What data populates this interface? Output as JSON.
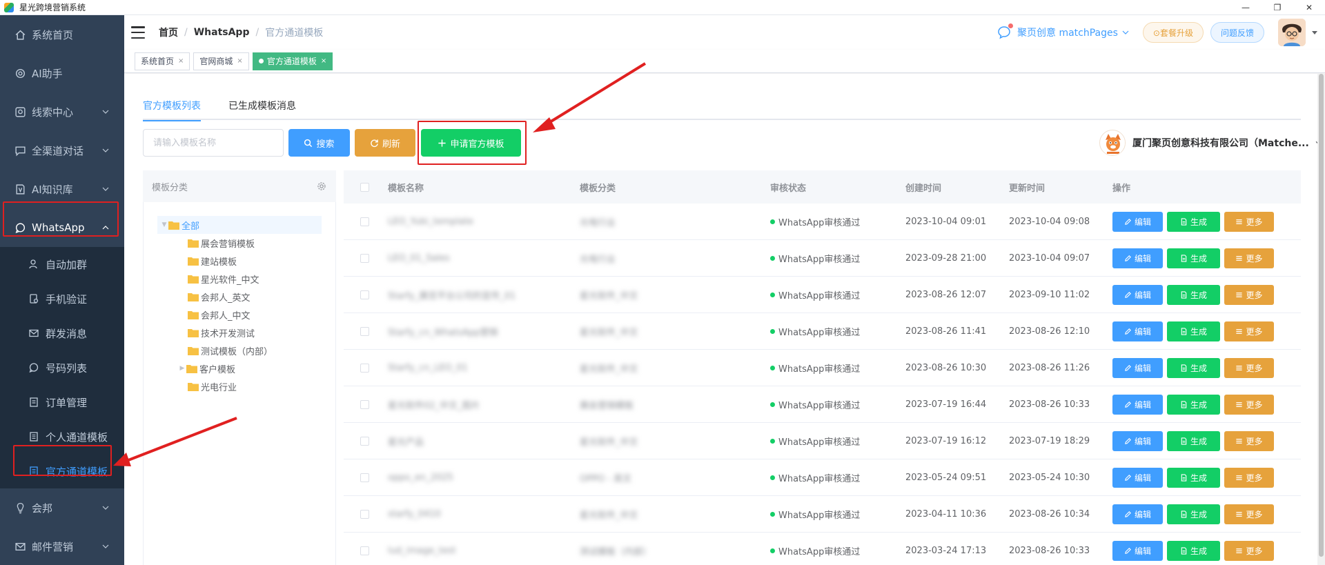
{
  "window": {
    "title": "星光跨境营销系统",
    "controls": [
      "—",
      "❐",
      "✕"
    ]
  },
  "sidebar": {
    "items": [
      {
        "label": "系统首页",
        "icon": "home-icon"
      },
      {
        "label": "AI助手",
        "icon": "ai-assistant-icon"
      },
      {
        "label": "线索中心",
        "icon": "clue-icon"
      },
      {
        "label": "全渠道对话",
        "icon": "chat-icon"
      },
      {
        "label": "AI知识库",
        "icon": "knowledge-icon"
      },
      {
        "label": "WhatsApp",
        "icon": "whatsapp-icon"
      },
      {
        "label": "会邦",
        "icon": "bulb-icon"
      },
      {
        "label": "邮件营销",
        "icon": "mail-icon"
      }
    ],
    "whatsapp_submenu": [
      {
        "label": "自动加群",
        "icon": "user-add-icon"
      },
      {
        "label": "手机验证",
        "icon": "phone-verify-icon"
      },
      {
        "label": "群发消息",
        "icon": "broadcast-icon"
      },
      {
        "label": "号码列表",
        "icon": "whatsapp-icon"
      },
      {
        "label": "订单管理",
        "icon": "order-icon"
      },
      {
        "label": "个人通道模板",
        "icon": "doc-icon"
      },
      {
        "label": "官方通道模板",
        "icon": "doc-icon"
      }
    ]
  },
  "header": {
    "breadcrumb": [
      "首页",
      "WhatsApp",
      "官方通道模板"
    ],
    "separator": "/",
    "company": "聚页创意 matchPages",
    "upgrade_label": "⊙套餐升级",
    "feedback_label": "问题反馈"
  },
  "tags": [
    {
      "label": "系统首页",
      "close": "×"
    },
    {
      "label": "官网商城",
      "close": "×"
    },
    {
      "label": "官方通道模板",
      "close": "×",
      "active": true
    }
  ],
  "tabs": [
    "官方模板列表",
    "已生成模板消息"
  ],
  "toolbar": {
    "search_placeholder": "请输入模板名称",
    "search_label": "搜索",
    "refresh_label": "刷新",
    "apply_label": "申请官方模板",
    "org_name": "厦门聚页创意科技有限公司（Matche..."
  },
  "category": {
    "header": "模板分类",
    "root": "全部",
    "nodes": [
      "展会营销模板",
      "建站模板",
      "星光软件_中文",
      "会邦人_英文",
      "会邦人_中文",
      "技术开发测试",
      "测试模板（内部）",
      "客户模板",
      "光电行业"
    ]
  },
  "table": {
    "columns": [
      "模板名称",
      "模板分类",
      "审核状态",
      "创建时间",
      "更新时间",
      "操作"
    ],
    "buttons": {
      "edit": "编辑",
      "generate": "生成",
      "more": "更多"
    },
    "rows": [
      {
        "name": "LEO_Yubi_template",
        "category": "光电行业",
        "status": "WhatsApp审核通过",
        "created": "2023-10-04 09:01",
        "updated": "2023-10-04 09:08"
      },
      {
        "name": "LEO_01_Sales",
        "category": "光电行业",
        "status": "WhatsApp审核通过",
        "created": "2023-09-28 21:00",
        "updated": "2023-10-04 09:07"
      },
      {
        "name": "Starfy_展览平台公司的宣传_01",
        "category": "星光软件_中文",
        "status": "WhatsApp审核通过",
        "created": "2023-08-26 12:07",
        "updated": "2023-09-10 11:02"
      },
      {
        "name": "Starfy_cn_WhatsApp营销",
        "category": "星光软件_中文",
        "status": "WhatsApp审核通过",
        "created": "2023-08-26 11:41",
        "updated": "2023-08-26 12:10"
      },
      {
        "name": "Starfy_cn_LEO_01",
        "category": "星光软件_中文",
        "status": "WhatsApp审核通过",
        "created": "2023-08-26 10:30",
        "updated": "2023-08-26 11:26"
      },
      {
        "name": "星光软件02_中文_图片",
        "category": "展会营销模板",
        "status": "WhatsApp审核通过",
        "created": "2023-07-19 16:44",
        "updated": "2023-08-26 10:33"
      },
      {
        "name": "星光产品",
        "category": "星光软件_中文",
        "status": "WhatsApp审核通过",
        "created": "2023-07-19 16:12",
        "updated": "2023-07-19 18:29"
      },
      {
        "name": "oppo_en_2025",
        "category": "OPPO - 英文",
        "status": "WhatsApp审核通过",
        "created": "2023-05-24 09:51",
        "updated": "2023-05-24 10:30"
      },
      {
        "name": "starfy_0410",
        "category": "星光软件_中文",
        "status": "WhatsApp审核通过",
        "created": "2023-04-11 10:36",
        "updated": "2023-08-26 10:34"
      },
      {
        "name": "lud_image_test",
        "category": "测试模板（内部）",
        "status": "WhatsApp审核通过",
        "created": "2023-03-24 17:13",
        "updated": "2023-08-26 10:33"
      }
    ]
  },
  "colors": {
    "sidebar_bg": "#304156",
    "submenu_bg": "#1f2d3d",
    "primary": "#409eff",
    "success": "#13ce66",
    "warning": "#e6a23c",
    "tag_active": "#42b983",
    "annotation_red": "#e02020"
  }
}
